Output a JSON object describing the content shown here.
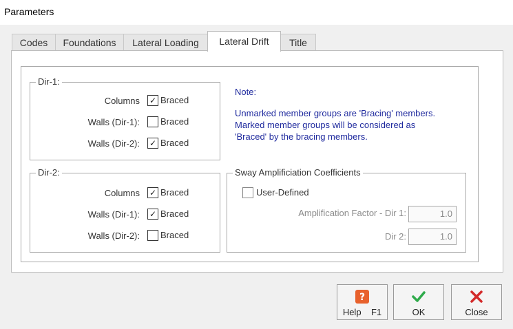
{
  "window": {
    "title": "Parameters"
  },
  "tabs": [
    {
      "label": "Codes"
    },
    {
      "label": "Foundations"
    },
    {
      "label": "Lateral Loading"
    },
    {
      "label": "Lateral Drift"
    },
    {
      "label": "Title"
    }
  ],
  "active_tab": "Lateral Drift",
  "dir1": {
    "legend": "Dir-1:",
    "rows": [
      {
        "label": "Columns",
        "checkbox": "Braced",
        "checked": true
      },
      {
        "label": "Walls (Dir-1):",
        "checkbox": "Braced",
        "checked": false
      },
      {
        "label": "Walls (Dir-2):",
        "checkbox": "Braced",
        "checked": true
      }
    ]
  },
  "dir2": {
    "legend": "Dir-2:",
    "rows": [
      {
        "label": "Columns",
        "checkbox": "Braced",
        "checked": true
      },
      {
        "label": "Walls (Dir-1):",
        "checkbox": "Braced",
        "checked": true
      },
      {
        "label": "Walls (Dir-2):",
        "checkbox": "Braced",
        "checked": false
      }
    ]
  },
  "note": {
    "heading": "Note:",
    "line1": "Unmarked member groups are 'Bracing' members.",
    "line2": "Marked member groups will be considered as",
    "line3": "'Braced' by the bracing members."
  },
  "sway": {
    "legend": "Sway Amplificiation Coefficients",
    "user_defined_label": "User-Defined",
    "user_defined_checked": false,
    "factor_dir1_label": "Amplification Factor - Dir 1:",
    "factor_dir1_value": "1.0",
    "factor_dir2_label": "Dir 2:",
    "factor_dir2_value": "1.0"
  },
  "buttons": {
    "help_label": "Help    F1",
    "ok_label": "OK",
    "close_label": "Close"
  },
  "icons": {
    "help": "question-mark-icon",
    "ok": "check-icon",
    "close": "x-icon"
  },
  "colors": {
    "note_text": "#1f2a9e",
    "help_icon": "#e8612c",
    "ok_icon": "#2eaa4a",
    "close_icon": "#d32a2a"
  },
  "check_glyph": "✓"
}
